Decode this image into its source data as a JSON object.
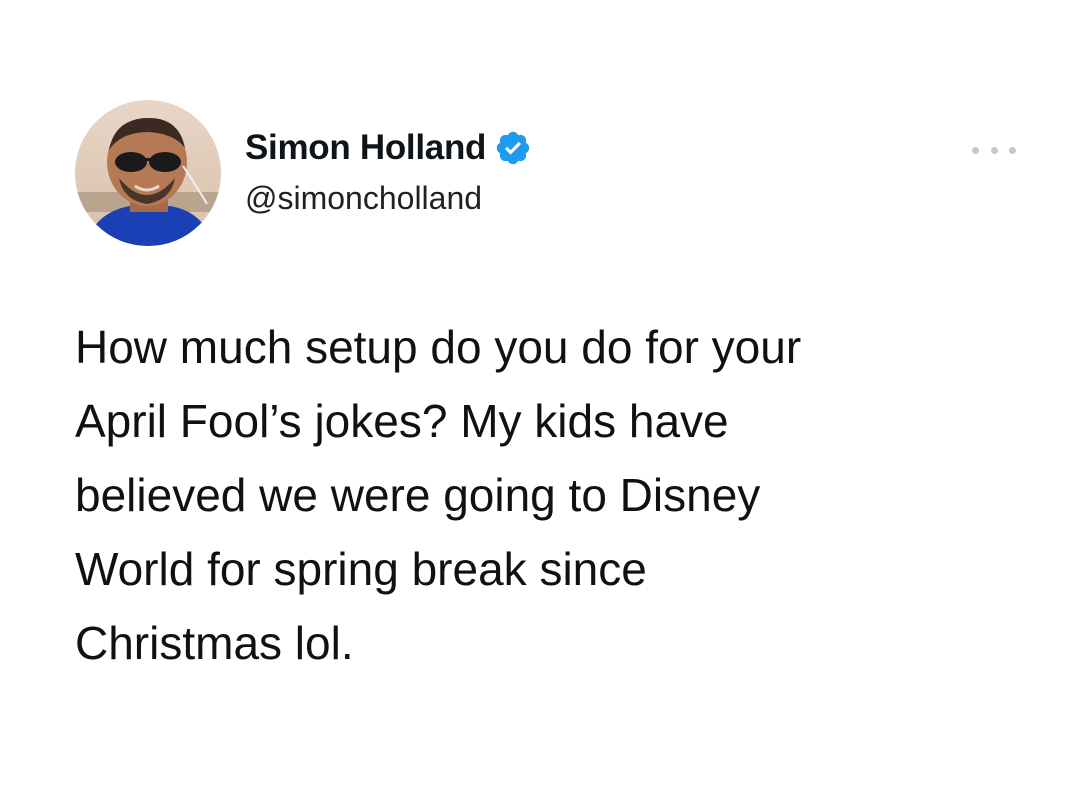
{
  "author": {
    "display_name": "Simon Holland",
    "handle": "@simoncholland",
    "verified": true,
    "verified_color": "#1d9bf0",
    "avatar_icon": "profile-photo"
  },
  "tweet": {
    "text": "How much setup do you do for your\nApril Fool’s jokes? My kids have\nbelieved we were going to Disney\nWorld for spring break since\nChristmas lol."
  },
  "more_menu": {
    "icon": "more-horizontal-icon"
  }
}
